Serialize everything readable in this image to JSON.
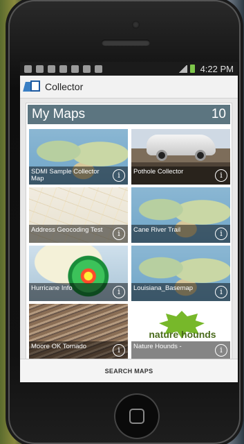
{
  "status_bar": {
    "time": "4:22 PM"
  },
  "app": {
    "name": "Collector"
  },
  "my_maps": {
    "title": "My Maps",
    "count": "10",
    "items": [
      {
        "label": "SDMI Sample Collector Map"
      },
      {
        "label": "Pothole Collector"
      },
      {
        "label": "Address Geocoding Test"
      },
      {
        "label": "Cane River Trail"
      },
      {
        "label": "Hurricane Info"
      },
      {
        "label": "Louisiana_Basemap"
      },
      {
        "label": "Moore OK Tornado"
      },
      {
        "label": "Nature Hounds -"
      }
    ]
  },
  "nature_logo_text": "nature hounds",
  "search_button": {
    "label": "SEARCH MAPS"
  },
  "info_glyph": "i"
}
